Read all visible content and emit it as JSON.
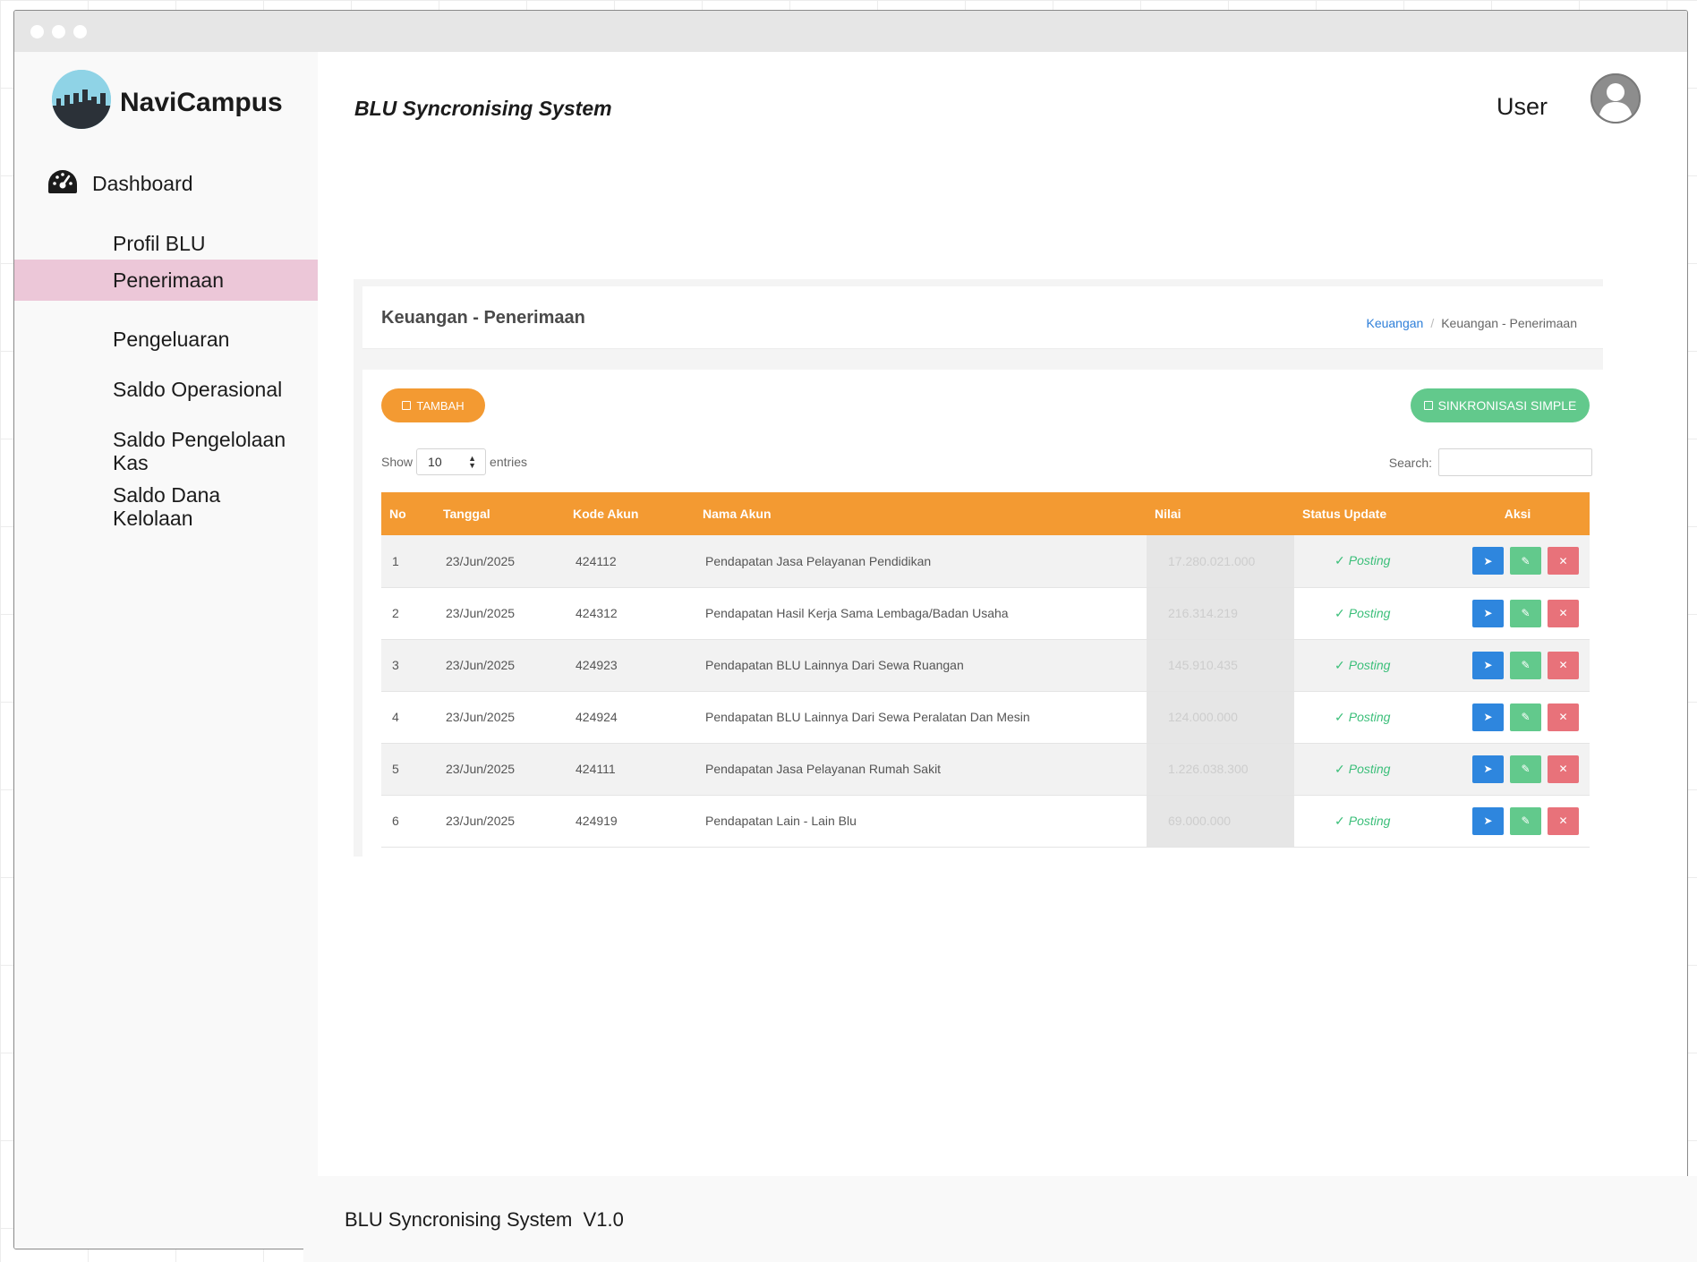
{
  "app": {
    "name": "NaviCampus",
    "title": "BLU Syncronising System"
  },
  "user": {
    "label": "User"
  },
  "sidebar": {
    "dashboard": "Dashboard",
    "items": [
      {
        "label": "Profil BLU",
        "active": false
      },
      {
        "label": "Penerimaan",
        "active": true
      },
      {
        "label": "Pengeluaran",
        "active": false
      },
      {
        "label": "Saldo Operasional",
        "active": false
      },
      {
        "label": "Saldo Pengelolaan Kas",
        "active": false
      },
      {
        "label": "Saldo Dana Kelolaan",
        "active": false
      }
    ]
  },
  "page": {
    "heading": "Keuangan - Penerimaan",
    "breadcrumb": {
      "parent": "Keuangan",
      "separator": "/",
      "current": "Keuangan - Penerimaan"
    }
  },
  "toolbar": {
    "add_label": "TAMBAH",
    "sync_label": "SINKRONISASI SIMPLE"
  },
  "table_controls": {
    "show_label": "Show",
    "page_length": "10",
    "entries_label": "entries",
    "search_label": "Search:",
    "search_value": ""
  },
  "table": {
    "columns": [
      "No",
      "Tanggal",
      "Kode Akun",
      "Nama Akun",
      "Nilai",
      "Status Update",
      "Aksi"
    ],
    "rows": [
      {
        "no": "1",
        "tanggal": "23/Jun/2025",
        "kode": "424112",
        "nama": "Pendapatan Jasa Pelayanan Pendidikan",
        "nilai": "17.280.021.000",
        "status": "Posting"
      },
      {
        "no": "2",
        "tanggal": "23/Jun/2025",
        "kode": "424312",
        "nama": "Pendapatan Hasil Kerja Sama Lembaga/Badan Usaha",
        "nilai": "216.314.219",
        "status": "Posting"
      },
      {
        "no": "3",
        "tanggal": "23/Jun/2025",
        "kode": "424923",
        "nama": "Pendapatan BLU Lainnya Dari Sewa Ruangan",
        "nilai": "145.910.435",
        "status": "Posting"
      },
      {
        "no": "4",
        "tanggal": "23/Jun/2025",
        "kode": "424924",
        "nama": "Pendapatan BLU Lainnya Dari Sewa Peralatan Dan Mesin",
        "nilai": "124.000.000",
        "status": "Posting"
      },
      {
        "no": "5",
        "tanggal": "23/Jun/2025",
        "kode": "424111",
        "nama": "Pendapatan Jasa Pelayanan Rumah Sakit",
        "nilai": "1.226.038.300",
        "status": "Posting"
      },
      {
        "no": "6",
        "tanggal": "23/Jun/2025",
        "kode": "424919",
        "nama": "Pendapatan Lain - Lain Blu",
        "nilai": "69.000.000",
        "status": "Posting"
      }
    ],
    "row_actions": [
      {
        "icon": "send-icon",
        "glyph": "➤"
      },
      {
        "icon": "pencil-icon",
        "glyph": "✎"
      },
      {
        "icon": "close-icon",
        "glyph": "✕"
      }
    ]
  },
  "footer": {
    "text": "BLU Syncronising System  V1.0"
  },
  "colors": {
    "accent": "#f39a32",
    "sync_green": "#62c98c",
    "active_nav": "#ecc7d8",
    "action_blue": "#2e86de",
    "action_red": "#e8727a",
    "status_green": "#3cbf7a"
  }
}
